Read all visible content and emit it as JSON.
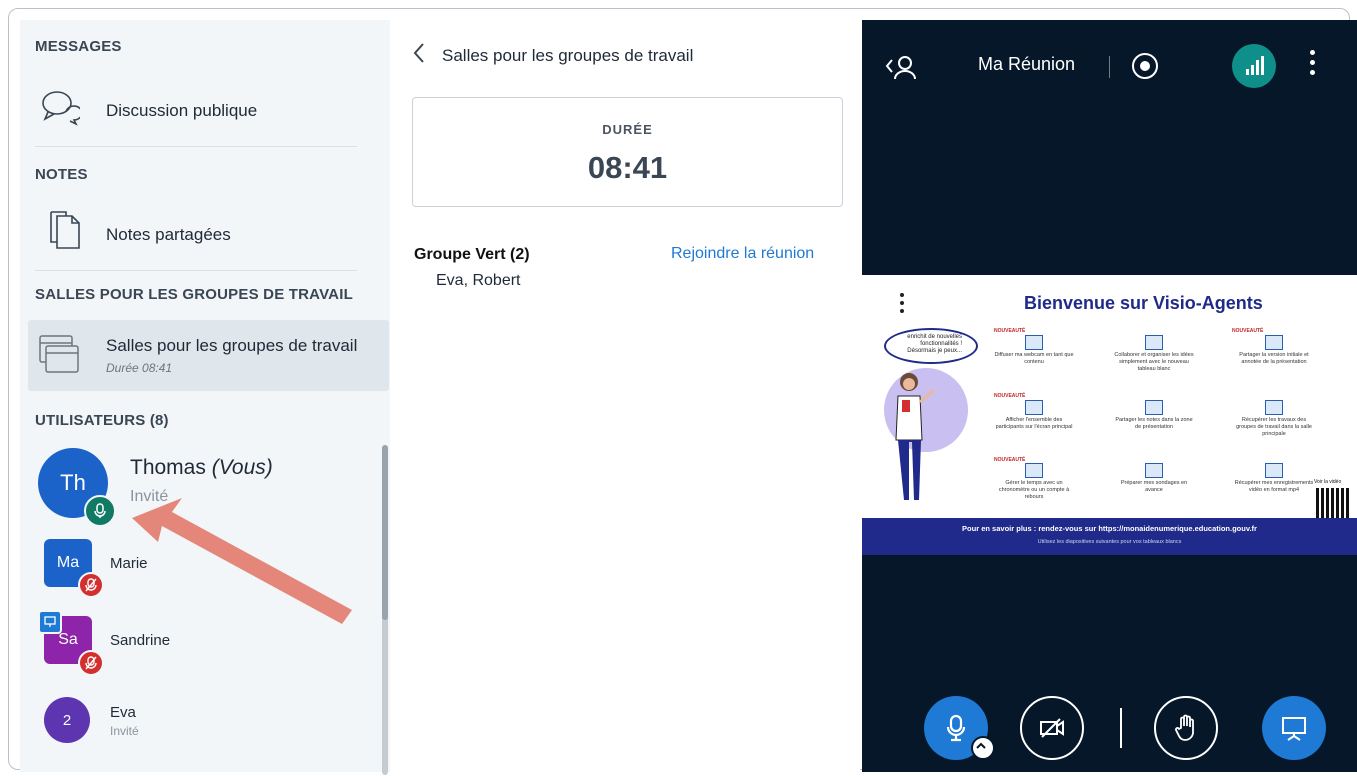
{
  "sidebar": {
    "messages_title": "MESSAGES",
    "public_chat": "Discussion publique",
    "notes_title": "NOTES",
    "shared_notes": "Notes partagées",
    "rooms_title": "SALLES POUR LES GROUPES DE TRAVAIL",
    "rooms_item": "Salles pour les groupes de travail",
    "rooms_item_duration": "Durée 08:41",
    "users_title": "UTILISATEURS (8)",
    "users": [
      {
        "initials": "Th",
        "name": "Thomas",
        "you": "(Vous)",
        "role": "Invité",
        "color": "#1b62c9",
        "status": "mic-on"
      },
      {
        "initials": "Ma",
        "name": "Marie",
        "role": "",
        "color": "#1b62c9",
        "status": "muted"
      },
      {
        "initials": "Sa",
        "name": "Sandrine",
        "role": "",
        "color": "#8e24aa",
        "status": "muted-presenter"
      },
      {
        "initials": "2",
        "name": "Eva",
        "role": "Invité",
        "color": "#5e35b1",
        "status": "none"
      }
    ]
  },
  "middle": {
    "title": "Salles pour les groupes de travail",
    "timer_label": "DURÉE",
    "timer_value": "08:41",
    "group_name": "Groupe Vert (2)",
    "group_members": "Eva, Robert",
    "join_link": "Rejoindre la réunion"
  },
  "meeting": {
    "title": "Ma Réunion",
    "accent": "#0f8f8a",
    "slide": {
      "title": "Bienvenue sur Visio-Agents",
      "bubble": "enrichit de nouvelles fonctionnalités ! Désormais je peux...",
      "new_tag": "NOUVEAUTÉ",
      "features": [
        "Diffuser ma webcam en tant que contenu",
        "Collaborer et organiser les idées simplement avec le nouveau tableau blanc",
        "Partager la version initiale et annotée de la présentation",
        "Afficher l'ensemble des participants sur l'écran principal",
        "Partager les notes dans la zone de présentation",
        "Récupérer les travaux des groupes de travail dans la salle principale",
        "Gérer le temps avec un chronomètre ou un compte à rebours",
        "Préparer mes sondages en avance",
        "Récupérer mes enregistrements vidéo en format mp4"
      ],
      "qr_label": "Voir la vidéo",
      "footer_line1": "Pour en savoir plus : rendez-vous sur https://monaidenumerique.education.gouv.fr",
      "footer_line2": "Utilisez les diapositives suivantes pour vos tableaux blancs"
    }
  }
}
